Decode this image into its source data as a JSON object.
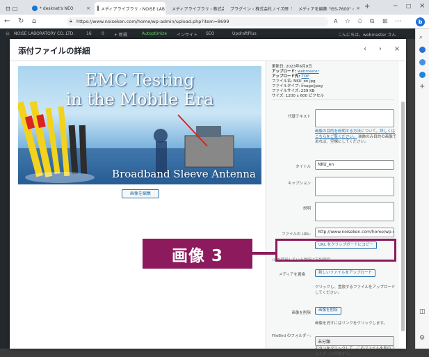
{
  "browser": {
    "tabs": [
      {
        "label": "* desknet's NEO"
      },
      {
        "label": "メディアライブラリ ‹ NOISE LAB"
      },
      {
        "label": "メディアライブラリ ‹ 株式会社ノ"
      },
      {
        "label": "プラグイン ‹ 株式会社ノイズ研"
      },
      {
        "label": "メディアを編集 \"ISS-7600\" ‹ "
      }
    ],
    "url": "https://www.noiseken.com/home/wp-admin/upload.php?item=8699",
    "new_tab": "+",
    "window_controls": {
      "minimize": "−",
      "maximize": "□",
      "close": "×"
    }
  },
  "wp_admin_bar": {
    "site": "NOISE LABORATORY CO.,LTD.",
    "updates": "16",
    "comments": "0",
    "new": "+ 新規",
    "autoptimize": "Autoptimize",
    "insight": "インサイト",
    "seo": "SEO",
    "updraft": "UpdraftPlus",
    "greeting": "こんにちは、webmaster さん"
  },
  "modal": {
    "title": "添付ファイルの詳細",
    "prev": "‹",
    "next": "›",
    "close": "×",
    "edit_image_button": "画像を編集",
    "image": {
      "headline1": "EMC Testing",
      "headline2": "in the Mobile Era",
      "subtitle": "Broadband Sleeve Antenna"
    }
  },
  "details": {
    "uploaded_on": "更新日: 2023年6月9日",
    "uploaded_by_label": "アップロード:",
    "uploaded_by": "webmaster",
    "uploaded_to_label": "アップロード先:",
    "uploaded_to": "TOP",
    "file_name": "ファイル名: NKU_en.jpg",
    "file_type": "ファイルタイプ: image/jpeg",
    "file_size": "ファイルサイズ: 239 KB",
    "dimensions": "サイズ: 1200 x 600 ピクセル"
  },
  "form": {
    "alt_label": "代替テキスト",
    "alt_value": "",
    "alt_help_link": "画像の目的を説明する方法について。詳しくはこちらをご覧ください。",
    "alt_help_tail": "装飾のみ目的の画像であれば、空欄にしてください。",
    "title_label": "タイトル",
    "title_value": "NKU_en",
    "caption_label": "キャプション",
    "caption_value": "",
    "description_label": "説明",
    "description_value": "",
    "file_url_label": "ファイルの URL:",
    "file_url_value": "http://www.noiseken.com/home/wp-c",
    "copy_url_button": "URL をクリップボードにコピー",
    "used_in": "ル が使用している場所は下記項目",
    "replace_label": "メディアを置換",
    "replace_button": "新しいファイルをアップロード",
    "replace_help": "クリックし、置換するファイルをアップロードしてください。",
    "delete_label": "画像を削除",
    "delete_button": "画像を削除",
    "delete_help": "画像を消すにはリンクをクリックします。",
    "filebird_label": "FileBird のフォルダー:",
    "filebird_value": "未分類",
    "filebird_help": "ボタンをクリックして、このファイルを別のフォルダーに移動する。"
  },
  "callout": {
    "text": "画像 3"
  },
  "colors": {
    "callout": "#8c1a5c",
    "link": "#2271b1",
    "admin_bar": "#23282d"
  }
}
